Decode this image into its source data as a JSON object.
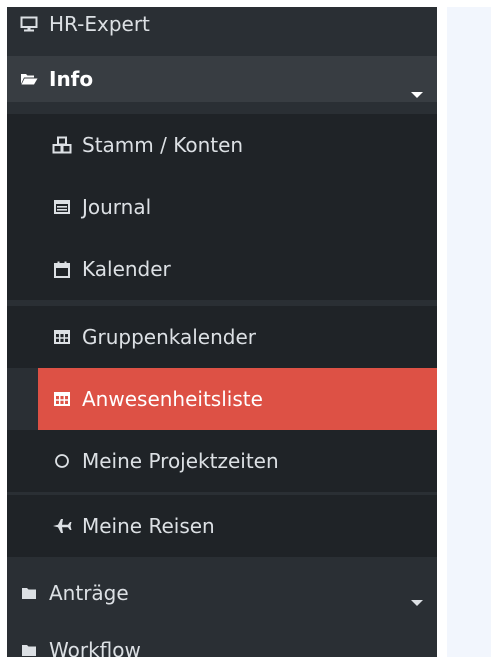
{
  "menu": {
    "hr_expert": {
      "label": "HR-Expert",
      "icon": "monitor-icon"
    },
    "info": {
      "label": "Info",
      "icon": "folder-open-icon",
      "expanded": true,
      "children": [
        {
          "label": "Stamm / Konten",
          "icon": "cubes-icon"
        },
        {
          "label": "Journal",
          "icon": "list-alt-icon"
        },
        {
          "label": "Kalender",
          "icon": "calendar-icon"
        },
        {
          "label": "Gruppenkalender",
          "icon": "table-icon"
        },
        {
          "label": "Anwesenheitsliste",
          "icon": "table-icon",
          "active": true
        },
        {
          "label": "Meine Projektzeiten",
          "icon": "circle-icon"
        },
        {
          "label": "Meine Reisen",
          "icon": "plane-icon"
        }
      ]
    },
    "antraege": {
      "label": "Anträge",
      "icon": "folder-icon"
    },
    "workflow": {
      "label": "Workflow",
      "icon": "folder-icon"
    }
  },
  "colors": {
    "sidebar_bg": "#2a2f34",
    "submenu_bg": "#1f2327",
    "open_header_bg": "#383d42",
    "active_bg": "#dd5145",
    "content_bg": "#f2f6fd"
  }
}
